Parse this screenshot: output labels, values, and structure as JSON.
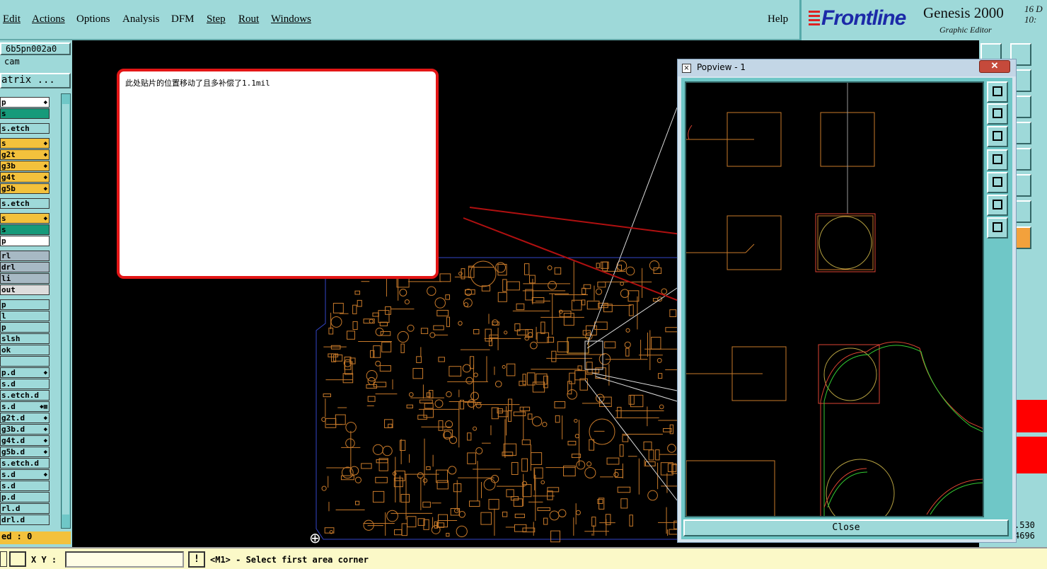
{
  "menu": {
    "items": [
      "Edit",
      "Actions",
      "Options",
      "Analysis",
      "DFM",
      "Step",
      "Rout",
      "Windows"
    ],
    "help": "Help"
  },
  "brand": {
    "logo": "Frontline",
    "title": "Genesis 2000",
    "subtitle": "Graphic Editor",
    "date_line1": "16  D",
    "date_line2": "10:"
  },
  "left_panel": {
    "job_name": "6b5pn002a0",
    "step_name": "cam",
    "matrix_button": "atrix ...",
    "layers": [
      {
        "name": "p",
        "color": "#ffffff",
        "flag": "◆"
      },
      {
        "name": "s",
        "color": "#169a7a",
        "flag": ""
      },
      {
        "name": "s.etch",
        "color": "#9ed9d9",
        "flag": ""
      },
      {
        "name": "s",
        "color": "#f3c13c",
        "flag": "◆"
      },
      {
        "name": "g2t",
        "color": "#f3c13c",
        "flag": "◆"
      },
      {
        "name": "g3b",
        "color": "#f3c13c",
        "flag": "◆"
      },
      {
        "name": "g4t",
        "color": "#f3c13c",
        "flag": "◆"
      },
      {
        "name": "g5b",
        "color": "#f3c13c",
        "flag": "◆"
      },
      {
        "name": "s.etch",
        "color": "#9ed9d9",
        "flag": ""
      },
      {
        "name": "s",
        "color": "#f3c13c",
        "flag": "◆"
      },
      {
        "name": "s",
        "color": "#169a7a",
        "flag": ""
      },
      {
        "name": "p",
        "color": "#ffffff",
        "flag": ""
      },
      {
        "name": "rl",
        "color": "#a7b9c4",
        "flag": ""
      },
      {
        "name": "drl",
        "color": "#a7b9c4",
        "flag": ""
      },
      {
        "name": "li",
        "color": "#a7b9c4",
        "flag": ""
      },
      {
        "name": "out",
        "color": "#dddddd",
        "flag": ""
      },
      {
        "name": "p",
        "color": "#9ed9d9",
        "flag": ""
      },
      {
        "name": "l",
        "color": "#9ed9d9",
        "flag": ""
      },
      {
        "name": "p",
        "color": "#9ed9d9",
        "flag": ""
      },
      {
        "name": "slsh",
        "color": "#9ed9d9",
        "flag": ""
      },
      {
        "name": "ok",
        "color": "#9ed9d9",
        "flag": ""
      },
      {
        "name": "",
        "color": "#9ed9d9",
        "flag": ""
      },
      {
        "name": "p.d",
        "color": "#9ed9d9",
        "flag": "◆"
      },
      {
        "name": "s.d",
        "color": "#9ed9d9",
        "flag": ""
      },
      {
        "name": "s.etch.d",
        "color": "#9ed9d9",
        "flag": ""
      },
      {
        "name": "s.d",
        "color": "#9ed9d9",
        "flag": "◆▦"
      },
      {
        "name": "g2t.d",
        "color": "#9ed9d9",
        "flag": "◆"
      },
      {
        "name": "g3b.d",
        "color": "#9ed9d9",
        "flag": "◆"
      },
      {
        "name": "g4t.d",
        "color": "#9ed9d9",
        "flag": "◆"
      },
      {
        "name": "g5b.d",
        "color": "#9ed9d9",
        "flag": "◆"
      },
      {
        "name": "s.etch.d",
        "color": "#9ed9d9",
        "flag": ""
      },
      {
        "name": "s.d",
        "color": "#9ed9d9",
        "flag": "◆"
      },
      {
        "name": "s.d",
        "color": "#9ed9d9",
        "flag": ""
      },
      {
        "name": "p.d",
        "color": "#9ed9d9",
        "flag": ""
      },
      {
        "name": "rl.d",
        "color": "#9ed9d9",
        "flag": ""
      },
      {
        "name": "drl.d",
        "color": "#9ed9d9",
        "flag": ""
      }
    ],
    "selected": "ed : 0"
  },
  "note": {
    "text": "此处贴片的位置移动了且多补偿了1.1mil"
  },
  "popview": {
    "title": "Popview - 1",
    "close_label": "Close"
  },
  "right_panel": {
    "coord1": ".530",
    "coord2": "4696"
  },
  "status": {
    "xy_label": "X Y :",
    "xy_value": "",
    "warn": "!",
    "message": "<M1> - Select first area corner"
  },
  "colors": {
    "panel": "#9ed9d9",
    "trace": "#c87a2a",
    "annotation_arrow": "#b01010",
    "status_bg": "#fbf9c8"
  }
}
